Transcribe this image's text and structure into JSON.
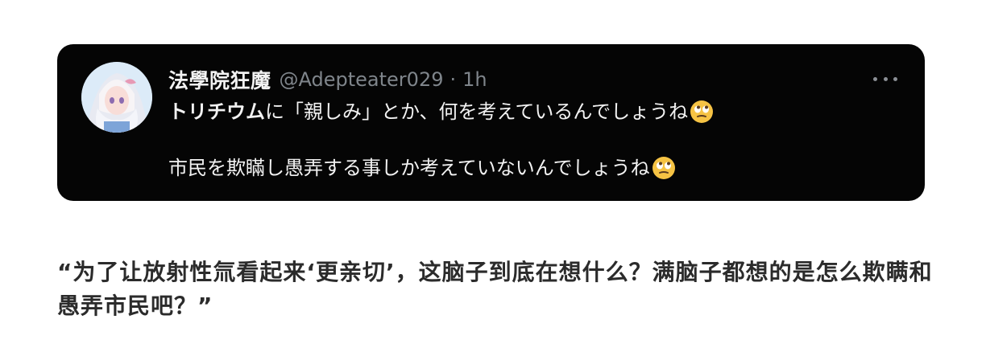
{
  "tweet": {
    "display_name": "法學院狂魔",
    "handle": "@Adepteater029",
    "separator": "·",
    "time": "1h",
    "line1_bold": "トリチウム",
    "line1_rest": "に「親しみ」とか、何を考えているんでしょうね",
    "line2": "市民を欺瞞し愚弄する事しか考えていないんでしょうね",
    "emoji": "face-with-rolling-eyes-icon"
  },
  "caption": {
    "text": "“为了让放射性氚看起来‘更亲切’，这脑子到底在想什么？满脑子都想的是怎么欺瞒和愚弄市民吧？”"
  },
  "colors": {
    "card_background": "#050505",
    "name_text": "#f2f2f2",
    "meta_text": "#7f858b",
    "caption_text": "#2b2b2b"
  }
}
